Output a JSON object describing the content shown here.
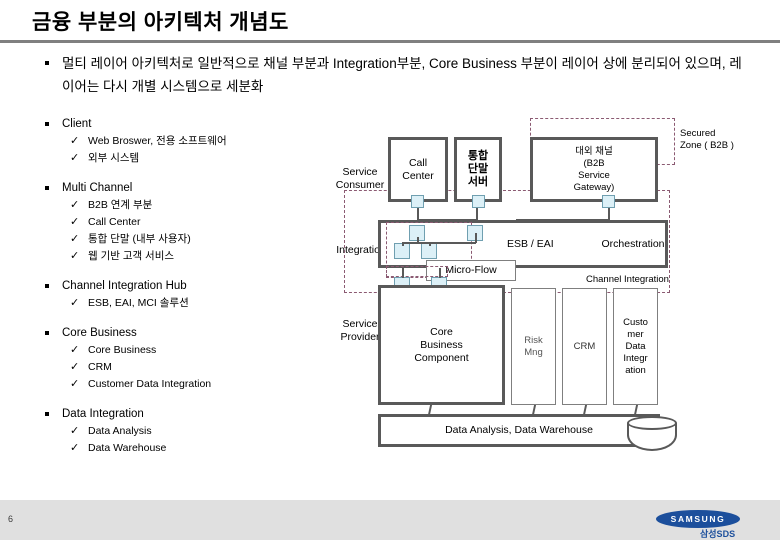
{
  "slide": {
    "title": "금융 부분의 아키텍처 개념도",
    "page_number": "6"
  },
  "lead": {
    "text": "멀티 레이어 아키텍처로 일반적으로 채널 부분과 Integration부분, Core Business 부분이 레이어 상에 분리되어 있으며, 레이어는 다시 개별 시스템으로 세분화"
  },
  "outline": {
    "groups": [
      {
        "heading": "Client",
        "items": [
          "Web Broswer, 전용 소프트웨어",
          "외부 시스템"
        ]
      },
      {
        "heading": "Multi Channel",
        "items": [
          "B2B 연계 부분",
          "Call Center",
          "통합 단말 (내부 사용자)",
          "웹 기반 고객 서비스"
        ]
      },
      {
        "heading": "Channel Integration Hub",
        "items": [
          "ESB, EAI, MCI 솔루션"
        ]
      },
      {
        "heading": "Core Business",
        "items": [
          "Core Business",
          "CRM",
          "Customer Data Integration"
        ]
      },
      {
        "heading": "Data Integration",
        "items": [
          "Data Analysis",
          "Data Warehouse"
        ]
      }
    ]
  },
  "diagram": {
    "lanes": [
      {
        "label": "Service\nConsumer"
      },
      {
        "label": "Integration"
      },
      {
        "label": "Service\nProvider"
      }
    ],
    "lane_service_consumer": "Service Consumer",
    "lane_integration": "Integration",
    "lane_service_provider": "Service Provider",
    "channel_boxes": [
      {
        "label": "Call\nCenter"
      },
      {
        "label": "통합\n단말\n서버"
      },
      {
        "label": "대외 채널\n(B2B\nService\nGateway)"
      }
    ],
    "call_center": "Call\nCenter",
    "terminal_server": "통합\n단말\n서버",
    "b2b_gateway": "대외 채널\n(B2B\nService\nGateway)",
    "esb_eai": "ESB / EAI",
    "orchestration": "Orchestration",
    "micro_flow": "Micro-Flow",
    "core_business_component": "Core\nBusiness\nComponent",
    "risk_mng": "Risk\nMng",
    "crm": "CRM",
    "customer_data_integration": "Custo\nmer\nData\nIntegr\nation",
    "data_warehouse": "Data Analysis, Data Warehouse",
    "zone_secured": "Secured\nZone ( B2B )",
    "zone_channel_integration": "Channel Integration"
  },
  "footer": {
    "logo_wordmark": "SAMSUNG",
    "logo_sub": "삼성SDS"
  },
  "colors": {
    "rule": "#808080",
    "box_border": "#595959",
    "zone_dash": "#8b5a72",
    "port_fill": "#dcf0f7",
    "footer_bg": "#e0e0e0",
    "brand_blue": "#1c4f9c"
  }
}
